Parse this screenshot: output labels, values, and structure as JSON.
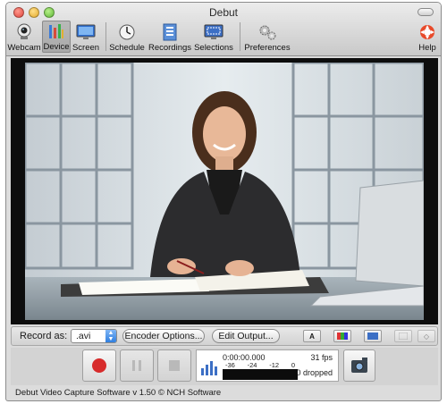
{
  "window": {
    "title": "Debut"
  },
  "toolbar": {
    "webcam": "Webcam",
    "device": "Device",
    "screen": "Screen",
    "schedule": "Schedule",
    "recordings": "Recordings",
    "selections": "Selections",
    "preferences": "Preferences",
    "help": "Help"
  },
  "record_bar": {
    "label": "Record as:",
    "format": ".avi",
    "encoder_button": "Encoder Options...",
    "edit_output_button": "Edit Output..."
  },
  "meter": {
    "time": "0:00:00.000",
    "fps": "31 fps",
    "dropped": "0 dropped",
    "scale_labels": [
      "-36",
      "-24",
      "-12",
      "0"
    ]
  },
  "status": {
    "text": "Debut Video Capture Software v 1.50 © NCH Software"
  },
  "colors": {
    "record_red": "#d72b2b",
    "active_tab": "#b0b0b0",
    "preview_bg": "#0d0d0d"
  }
}
